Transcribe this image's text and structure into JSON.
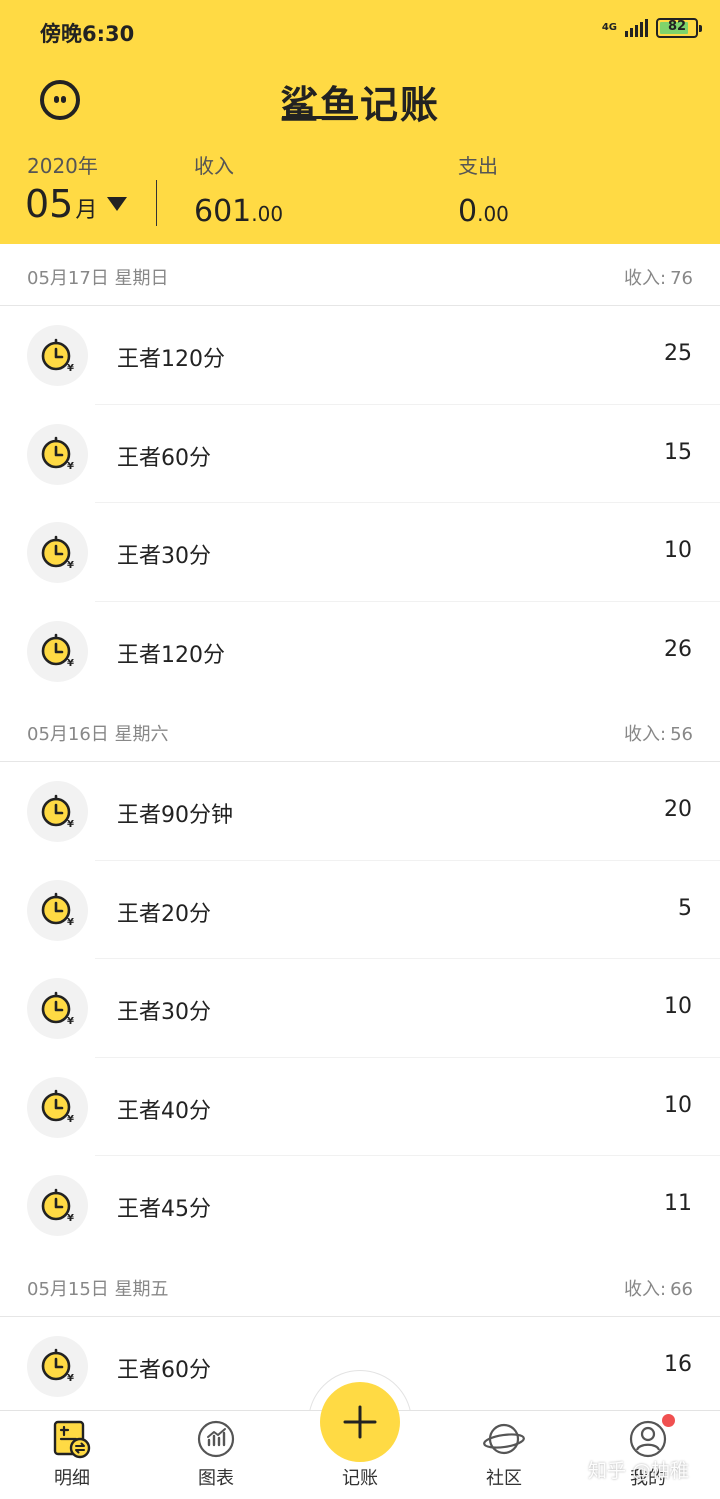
{
  "status_bar": {
    "time": "傍晚6:30",
    "network": "4G",
    "battery": "82"
  },
  "header": {
    "title": "鲨鱼记账",
    "year": "2020年",
    "month": "05",
    "month_unit": "月",
    "income_label": "收入",
    "income_int": "601",
    "income_dec": ".00",
    "expense_label": "支出",
    "expense_int": "0",
    "expense_dec": ".00",
    "accent_color": "#FFDA44"
  },
  "days": [
    {
      "date": "05月17日 星期日",
      "income_label": "收入:",
      "income": "76",
      "items": [
        {
          "title": "王者120分",
          "amount": "25",
          "icon": "clock-yen-icon"
        },
        {
          "title": "王者60分",
          "amount": "15",
          "icon": "clock-yen-icon"
        },
        {
          "title": "王者30分",
          "amount": "10",
          "icon": "clock-yen-icon"
        },
        {
          "title": "王者120分",
          "amount": "26",
          "icon": "clock-yen-icon"
        }
      ]
    },
    {
      "date": "05月16日 星期六",
      "income_label": "收入:",
      "income": "56",
      "items": [
        {
          "title": "王者90分钟",
          "amount": "20",
          "icon": "clock-yen-icon"
        },
        {
          "title": "王者20分",
          "amount": "5",
          "icon": "clock-yen-icon"
        },
        {
          "title": "王者30分",
          "amount": "10",
          "icon": "clock-yen-icon"
        },
        {
          "title": "王者40分",
          "amount": "10",
          "icon": "clock-yen-icon"
        },
        {
          "title": "王者45分",
          "amount": "11",
          "icon": "clock-yen-icon"
        }
      ]
    },
    {
      "date": "05月15日 星期五",
      "income_label": "收入:",
      "income": "66",
      "items": [
        {
          "title": "王者60分",
          "amount": "16",
          "icon": "clock-yen-icon"
        }
      ]
    }
  ],
  "tabbar": {
    "details": "明细",
    "charts": "图表",
    "add": "记账",
    "community": "社区",
    "mine": "我的"
  },
  "watermark": "知乎 @柚稚"
}
